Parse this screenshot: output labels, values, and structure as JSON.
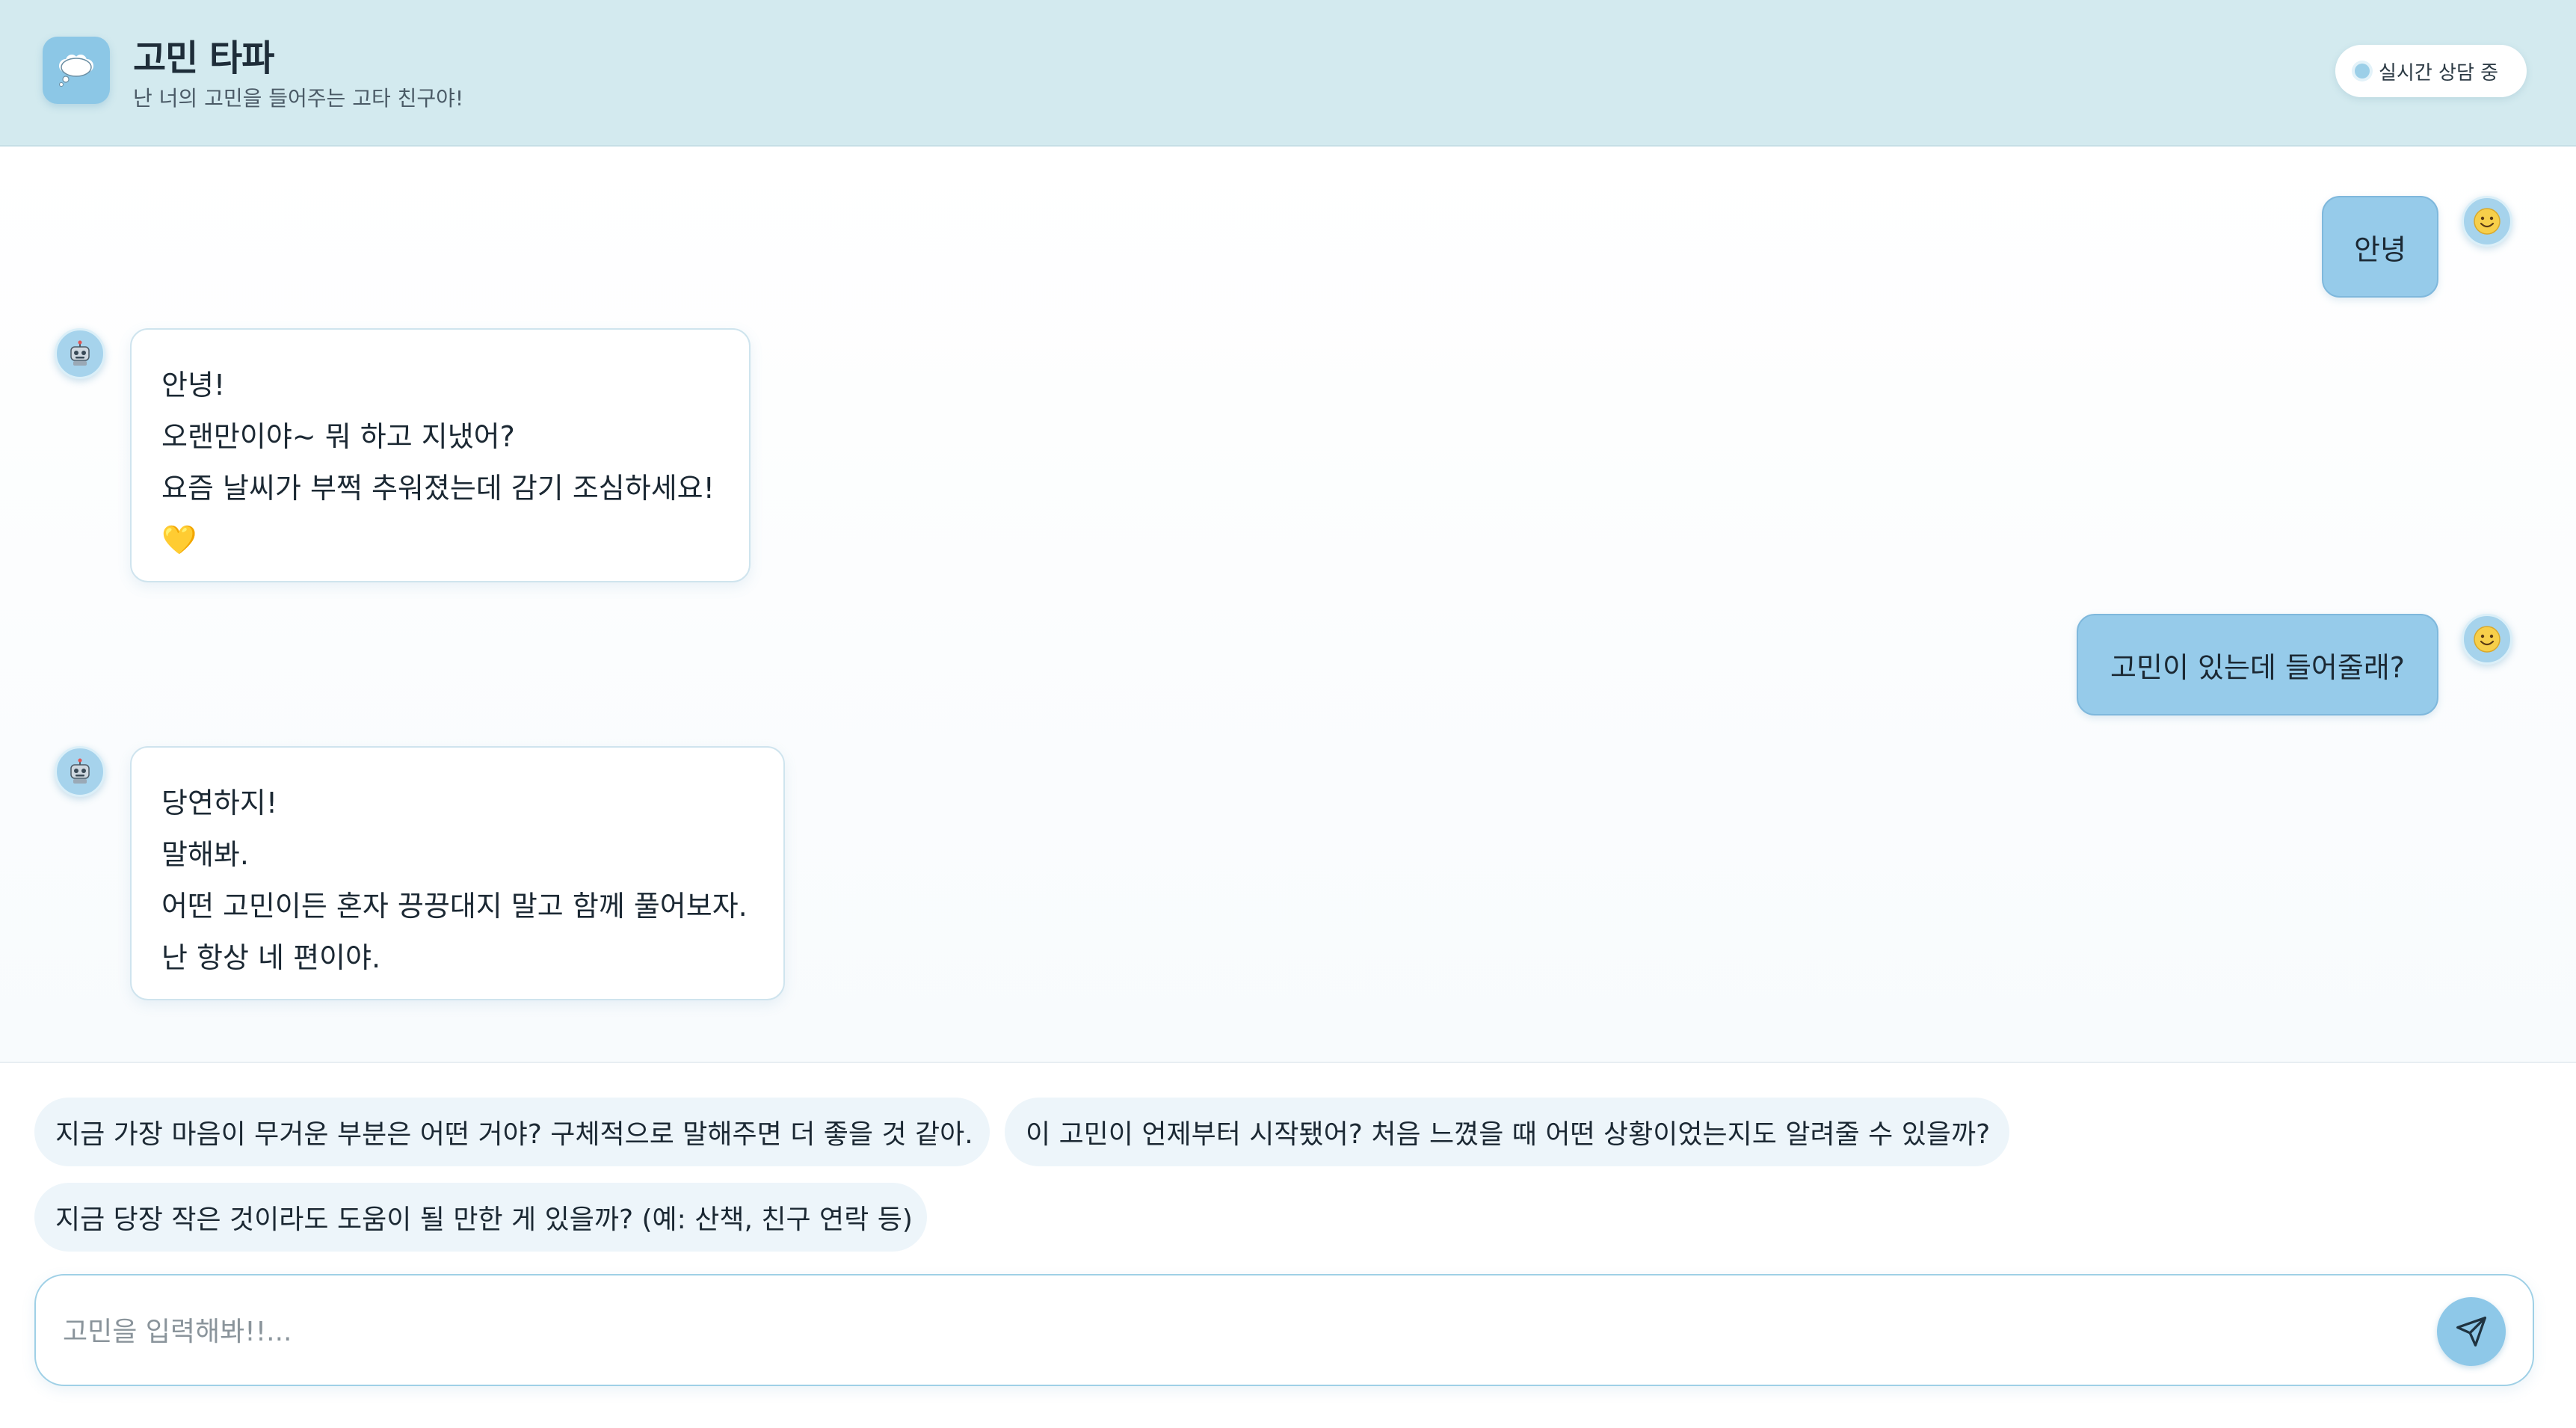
{
  "header": {
    "title": "고민 타파",
    "subtitle": "난 너의 고민을 들어주는 고타 친구야!",
    "logo_icon": "thought-bubble-icon",
    "status_label": "실시간 상담 중"
  },
  "messages": [
    {
      "role": "user",
      "text": "안녕",
      "avatar_icon": "smiley-face-icon"
    },
    {
      "role": "bot",
      "lines": [
        "안녕!",
        "오랜만이야~ 뭐 하고 지냈어?",
        "요즘 날씨가 부쩍 추워졌는데 감기 조심하세요!",
        "💛"
      ],
      "avatar_icon": "robot-icon"
    },
    {
      "role": "user",
      "text": "고민이 있는데 들어줄래?",
      "avatar_icon": "smiley-face-icon"
    },
    {
      "role": "bot",
      "lines": [
        "당연하지!",
        "말해봐.",
        "어떤 고민이든 혼자 끙끙대지 말고 함께 풀어보자.",
        "난 항상 네 편이야."
      ],
      "avatar_icon": "robot-icon"
    }
  ],
  "suggestions": [
    "지금 가장 마음이 무거운 부분은 어떤 거야? 구체적으로 말해주면 더 좋을 것 같아.",
    "이 고민이 언제부터 시작됐어? 처음 느꼈을 때 어떤 상황이었는지도 알려줄 수 있을까?",
    "지금 당장 작은 것이라도 도움이 될 만한 게 있을까? (예: 산책, 친구 연락 등)"
  ],
  "input": {
    "placeholder": "고민을 입력해봐!!...",
    "value": "",
    "send_icon": "send-icon"
  },
  "colors": {
    "header_bg": "#d3eaef",
    "accent": "#8ec8e8",
    "user_bubble": "#96cbea",
    "chip_bg": "#edf5fa"
  }
}
